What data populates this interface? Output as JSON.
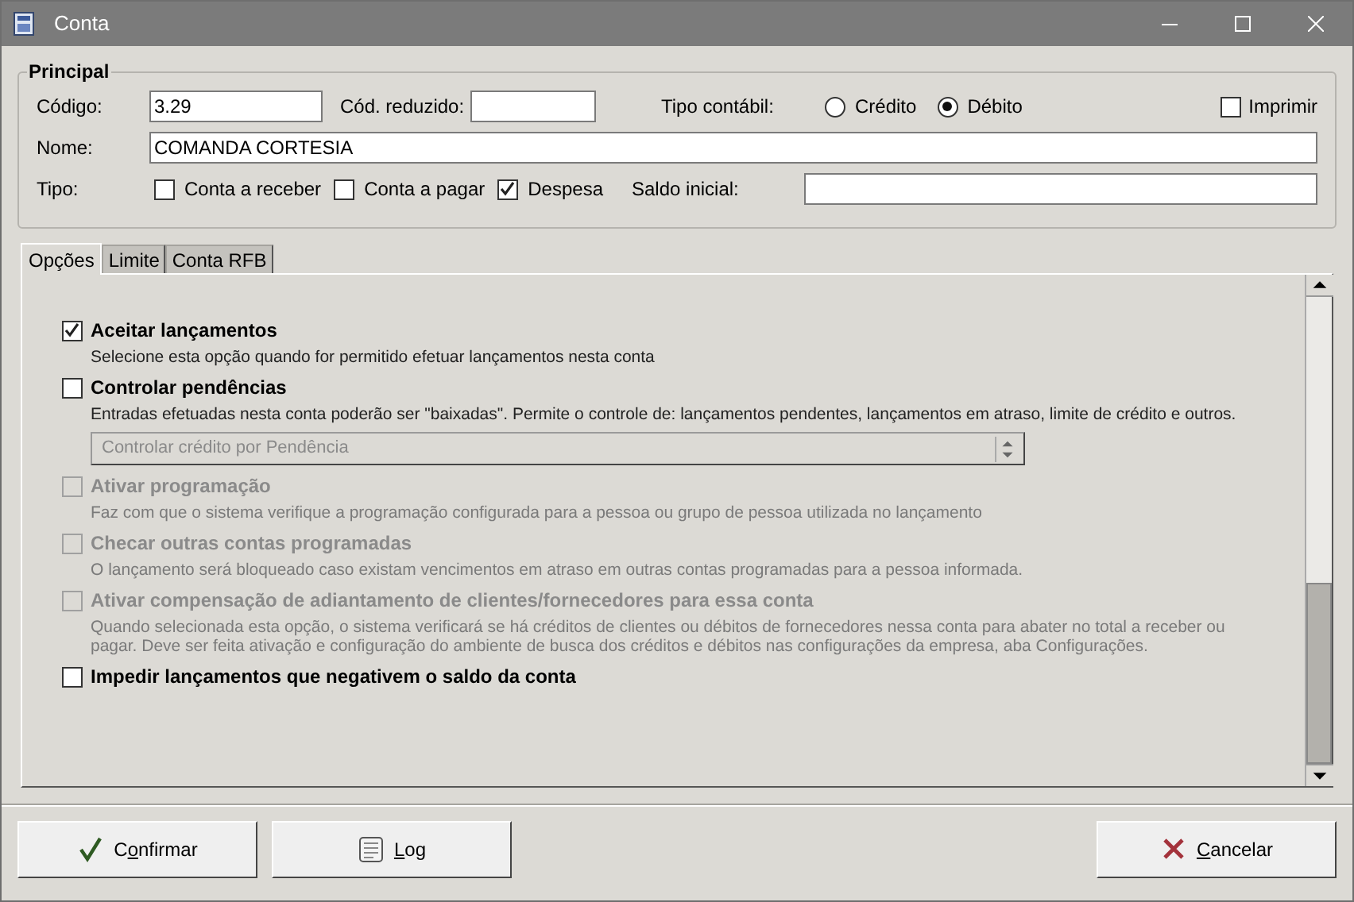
{
  "window": {
    "title": "Conta"
  },
  "principal": {
    "title": "Principal",
    "codigo": {
      "label": "Código:",
      "value": "3.29"
    },
    "cod_reduzido": {
      "label": "Cód. reduzido:"
    },
    "tipo_contabil": {
      "label": "Tipo contábil:",
      "options": [
        {
          "label": "Crédito",
          "selected": false
        },
        {
          "label": "Débito",
          "selected": true
        }
      ]
    },
    "imprimir": {
      "label": "Imprimir",
      "checked": false
    },
    "nome": {
      "label": "Nome:",
      "value": "COMANDA CORTESIA"
    },
    "tipo": {
      "label": "Tipo:",
      "options": [
        {
          "label": "Conta a receber",
          "checked": false
        },
        {
          "label": "Conta a pagar",
          "checked": false
        },
        {
          "label": "Despesa",
          "checked": true
        }
      ]
    },
    "saldo_inicial": {
      "label": "Saldo inicial:"
    }
  },
  "tabs": [
    {
      "label": "Opções",
      "selected": true
    },
    {
      "label": "Limite",
      "selected": false
    },
    {
      "label": "Conta RFB",
      "selected": false
    }
  ],
  "options": [
    {
      "label": "Aceitar lançamentos",
      "checked": true,
      "disabled": false,
      "description": "Selecione esta opção quando for permitido efetuar lançamentos nesta conta"
    },
    {
      "label": "Controlar pendências",
      "checked": false,
      "disabled": false,
      "description": "Entradas efetuadas nesta conta poderão ser \"baixadas\". Permite o controle de: lançamentos pendentes, lançamentos em atraso, limite de crédito e outros.",
      "select": {
        "value": "Controlar crédito por Pendência",
        "disabled": true
      }
    },
    {
      "label": "Ativar programação",
      "checked": false,
      "disabled": true,
      "description": "Faz com que o sistema verifique a programação configurada para a pessoa ou grupo de pessoa utilizada no lançamento"
    },
    {
      "label": "Checar outras contas programadas",
      "checked": false,
      "disabled": true,
      "description": "O lançamento será bloqueado caso existam vencimentos em atraso em outras contas programadas para a pessoa informada."
    },
    {
      "label": "Ativar compensação de adiantamento de clientes/fornecedores para essa conta",
      "checked": false,
      "disabled": true,
      "description": "Quando  selecionada esta opção, o sistema verificará se há créditos de clientes ou débitos de fornecedores nessa conta para abater no total a receber ou pagar. Deve ser feita ativação e configuração do ambiente de busca dos créditos e débitos nas configurações da empresa, aba Configurações."
    },
    {
      "label": "Impedir lançamentos que negativem o saldo da conta",
      "checked": false,
      "disabled": false
    }
  ],
  "buttons": [
    {
      "kind": "confirm",
      "label": "Confirmar"
    },
    {
      "kind": "log",
      "label": "Log"
    },
    {
      "kind": "cancel",
      "label": "Cancelar"
    }
  ]
}
